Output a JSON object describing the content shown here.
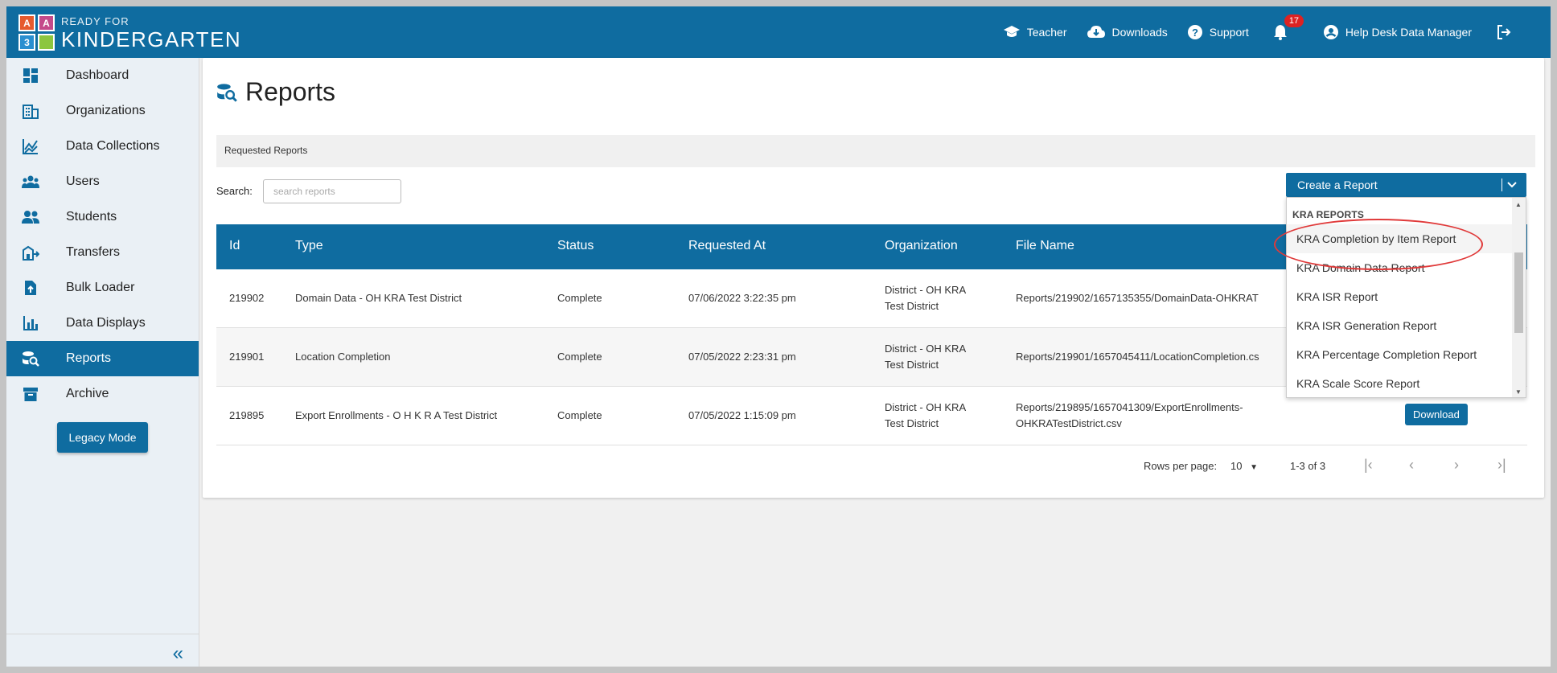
{
  "app": {
    "logo_letters": [
      "A",
      "A",
      "3",
      ""
    ],
    "logo_small": "READY FOR",
    "logo_big": "KINDERGARTEN",
    "brand_color": "#0f6ca0"
  },
  "topnav": {
    "teacher": "Teacher",
    "downloads": "Downloads",
    "support": "Support",
    "notifications_count": "17",
    "user": "Help Desk Data Manager"
  },
  "sidebar": {
    "items": [
      {
        "label": "Dashboard",
        "icon": "dashboard-icon"
      },
      {
        "label": "Organizations",
        "icon": "organizations-icon"
      },
      {
        "label": "Data Collections",
        "icon": "chart-icon"
      },
      {
        "label": "Users",
        "icon": "users-icon"
      },
      {
        "label": "Students",
        "icon": "students-icon"
      },
      {
        "label": "Transfers",
        "icon": "transfers-icon"
      },
      {
        "label": "Bulk Loader",
        "icon": "upload-file-icon"
      },
      {
        "label": "Data Displays",
        "icon": "bar-chart-icon"
      },
      {
        "label": "Reports",
        "icon": "reports-icon",
        "active": true
      },
      {
        "label": "Archive",
        "icon": "archive-icon"
      }
    ],
    "legacy_button": "Legacy Mode",
    "collapse_glyph": "«"
  },
  "main": {
    "title": "Reports",
    "subheader": "Requested Reports",
    "search_label": "Search:",
    "search_placeholder": "search reports",
    "create_button": "Create a Report",
    "table": {
      "headers": [
        "Id",
        "Type",
        "Status",
        "Requested At",
        "Organization",
        "File Name"
      ],
      "rows": [
        {
          "id": "219902",
          "type": "Domain Data - OH KRA Test District",
          "status": "Complete",
          "requested_at": "07/06/2022 3:22:35 pm",
          "org_line1": "District - OH KRA",
          "org_line2": "Test District",
          "file_line1": "Reports/219902/1657135355/DomainData-OHKRAT",
          "file_line2": ""
        },
        {
          "id": "219901",
          "type": "Location Completion",
          "status": "Complete",
          "requested_at": "07/05/2022 2:23:31 pm",
          "org_line1": "District - OH KRA",
          "org_line2": "Test District",
          "file_line1": "Reports/219901/1657045411/LocationCompletion.cs",
          "file_line2": ""
        },
        {
          "id": "219895",
          "type": "Export Enrollments - O H K R A Test District",
          "status": "Complete",
          "requested_at": "07/05/2022 1:15:09 pm",
          "org_line1": "District - OH KRA",
          "org_line2": "Test District",
          "file_line1": "Reports/219895/1657041309/ExportEnrollments-",
          "file_line2": "OHKRATestDistrict.csv",
          "action": "Download"
        }
      ]
    },
    "pagination": {
      "rows_per_page_label": "Rows per page:",
      "rows_per_page_value": "10",
      "range": "1-3 of 3"
    },
    "dropdown": {
      "group_label": "KRA REPORTS",
      "items": [
        "KRA Completion by Item Report",
        "KRA Domain Data Report",
        "KRA ISR Report",
        "KRA ISR Generation Report",
        "KRA Percentage Completion Report",
        "KRA Scale Score Report"
      ],
      "highlighted_item_index": 0,
      "annotation_color": "#e03a3a"
    }
  }
}
